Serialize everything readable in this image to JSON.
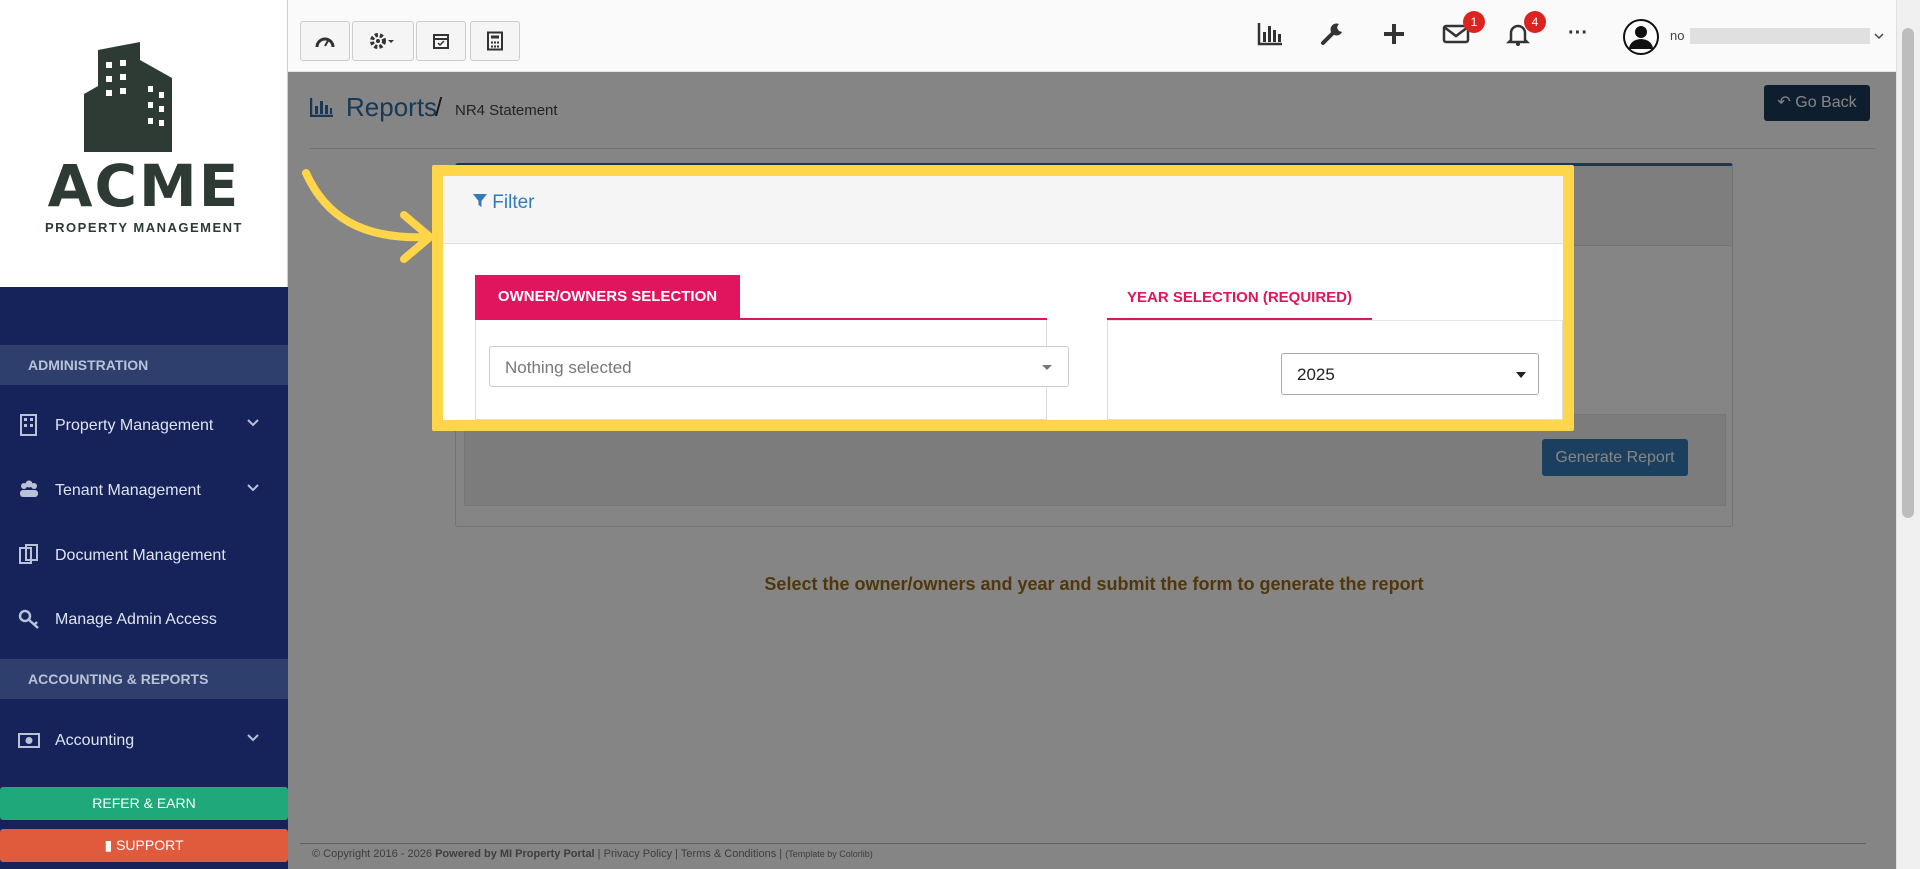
{
  "sidebar": {
    "brand_name": "ACME",
    "brand_sub": "PROPERTY MANAGEMENT",
    "section_admin": "ADMINISTRATION",
    "section_accounting": "ACCOUNTING & REPORTS",
    "items": [
      {
        "label": "Property Management",
        "icon": "building-icon"
      },
      {
        "label": "Tenant Management",
        "icon": "users-icon"
      },
      {
        "label": "Document Management",
        "icon": "documents-icon"
      },
      {
        "label": "Manage Admin Access",
        "icon": "key-icon"
      },
      {
        "label": "Accounting",
        "icon": "money-icon"
      }
    ],
    "refer_label": "REFER & EARN",
    "support_label": "SUPPORT"
  },
  "topbar": {
    "mail_count": "1",
    "notification_count": "4",
    "more_label": "···",
    "user_name": "no"
  },
  "breadcrumb": {
    "title": "Reports",
    "separator": "/",
    "current": "NR4 Statement"
  },
  "go_back_label": "Go Back",
  "filter": {
    "title": "Filter",
    "owner_tab_label": "OWNER/OWNERS SELECTION",
    "owner_placeholder": "Nothing selected",
    "year_tab_label": "YEAR SELECTION (REQUIRED)",
    "year_value": "2025"
  },
  "generate_label": "Generate Report",
  "info_text": "Select the owner/owners and year and submit the form to generate the report",
  "footer": {
    "copyright": "© Copyright 2016 - 2026",
    "powered": "Powered by MI Property Portal",
    "privacy": "Privacy Policy",
    "terms": "Terms & Conditions",
    "template": "(Template by Colorlib)"
  },
  "colors": {
    "highlight": "#ffd54a",
    "accent_pink": "#e0155e",
    "sidebar_bg": "#16235a",
    "link_blue": "#337ab7"
  }
}
